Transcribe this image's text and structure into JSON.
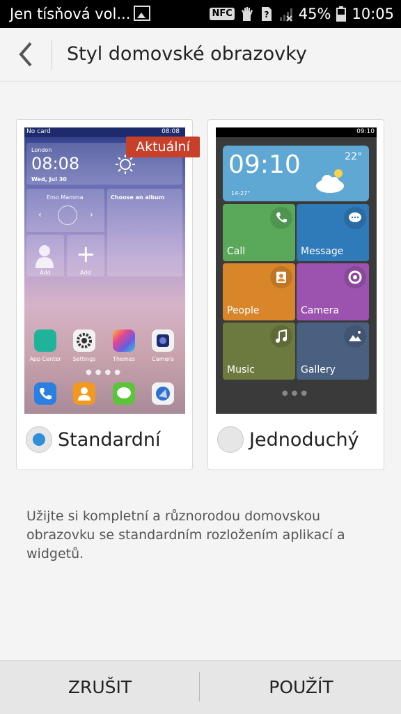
{
  "status_bar": {
    "notification_text": "Jen tísňová vol...",
    "nfc_label": "NFC",
    "battery_percent": "45%",
    "time": "10:05",
    "icons": [
      "gallery-icon",
      "nfc-icon",
      "glove-icon",
      "sim-unknown-icon",
      "signal-none-icon",
      "battery-icon"
    ]
  },
  "header": {
    "title": "Styl domovské obrazovky"
  },
  "options": [
    {
      "label": "Standardní",
      "selected": true,
      "badge": "Aktuální",
      "preview": {
        "status_left": "No card",
        "status_time": "08:08",
        "weather_city": "London",
        "clock": "08:08",
        "date": "Wed, Jul 30",
        "music_title": "Emo Mamma",
        "album_prompt": "Choose an album",
        "add_label_1": "Add",
        "add_label_2": "Add",
        "apps": [
          "App Center",
          "Settings",
          "Themes",
          "Camera"
        ]
      }
    },
    {
      "label": "Jednoduchý",
      "selected": false,
      "preview": {
        "status_time": "09:10",
        "clock": "09:10",
        "temperature": "22°",
        "temp_range": "14-27°",
        "tiles": [
          {
            "label": "Call",
            "color": "#5aa95a"
          },
          {
            "label": "Message",
            "color": "#2f7ab9"
          },
          {
            "label": "People",
            "color": "#d9862b"
          },
          {
            "label": "Camera",
            "color": "#9c53b0"
          },
          {
            "label": "Music",
            "color": "#6d7a3f"
          },
          {
            "label": "Gallery",
            "color": "#4a6081"
          }
        ]
      }
    }
  ],
  "description": "Užijte si kompletní a různorodou domovskou obrazovku se standardním rozložením aplikací a widgetů.",
  "buttons": {
    "cancel": "ZRUŠIT",
    "apply": "POUŽÍT"
  },
  "colors": {
    "accent": "#2f8fd9",
    "badge": "#c8402a"
  }
}
